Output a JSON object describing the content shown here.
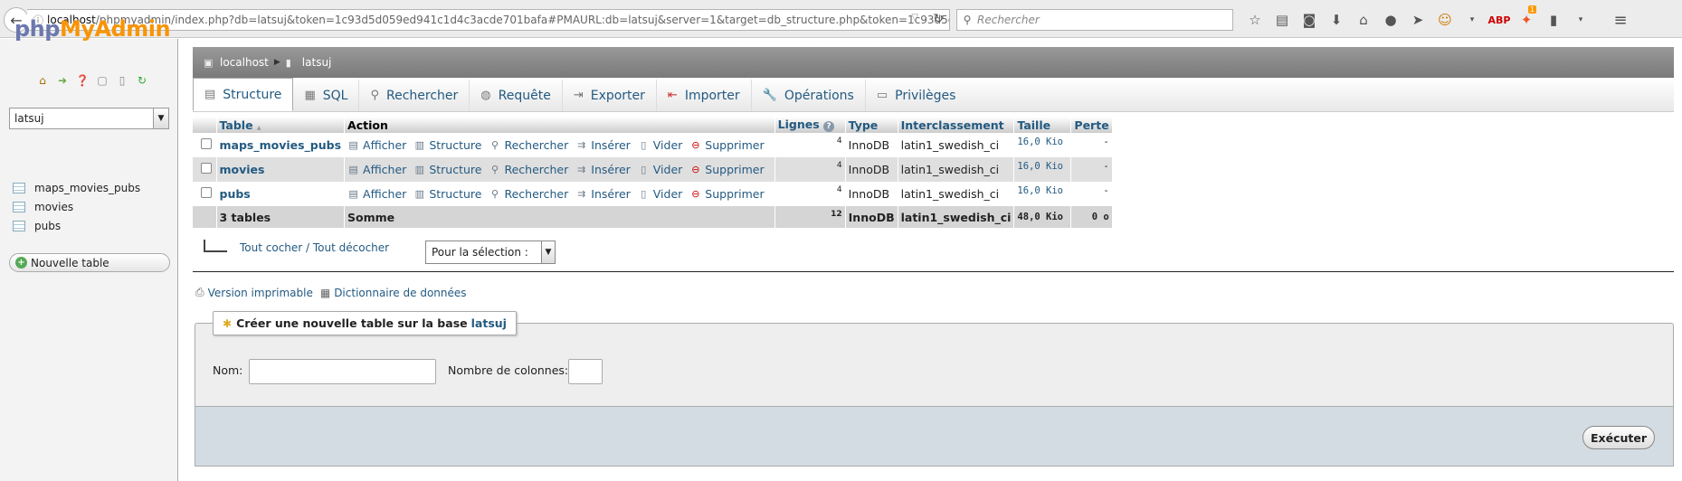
{
  "browser": {
    "url_host": "localhost",
    "url_rest": "/phpmyadmin/index.php?db=latsuj&token=1c93d5d059ed941c1d4c3acde701bafa#PMAURL:db=latsuj&server=1&target=db_structure.php&token=1c93d5d059ed941c1",
    "search_placeholder": "Rechercher",
    "badge": "1"
  },
  "sidebar": {
    "logo_php": "php",
    "logo_my": "MyAdmin",
    "db_selected": "latsuj",
    "tables": [
      {
        "label": "maps_movies_pubs"
      },
      {
        "label": "movies"
      },
      {
        "label": "pubs"
      }
    ],
    "new_table": "Nouvelle table"
  },
  "breadcrumb": {
    "server": "localhost",
    "db": "latsuj"
  },
  "tabs": [
    {
      "label": "Structure",
      "icon": "structure-icon"
    },
    {
      "label": "SQL",
      "icon": "sql-icon"
    },
    {
      "label": "Rechercher",
      "icon": "search-icon"
    },
    {
      "label": "Requête",
      "icon": "query-icon"
    },
    {
      "label": "Exporter",
      "icon": "export-icon"
    },
    {
      "label": "Importer",
      "icon": "import-icon"
    },
    {
      "label": "Opérations",
      "icon": "wrench-icon"
    },
    {
      "label": "Privilèges",
      "icon": "privileges-icon"
    }
  ],
  "table": {
    "headers": {
      "table": "Table",
      "sort_arrow": "▲",
      "action": "Action",
      "rows": "Lignes",
      "type": "Type",
      "collation": "Interclassement",
      "size": "Taille",
      "overhead": "Perte"
    },
    "actions": {
      "browse": "Afficher",
      "structure": "Structure",
      "search": "Rechercher",
      "insert": "Insérer",
      "empty": "Vider",
      "drop": "Supprimer"
    },
    "rows": [
      {
        "name": "maps_movies_pubs",
        "rows": "4",
        "type": "InnoDB",
        "collation": "latin1_swedish_ci",
        "size": "16,0 Kio",
        "overhead": "-"
      },
      {
        "name": "movies",
        "rows": "4",
        "type": "InnoDB",
        "collation": "latin1_swedish_ci",
        "size": "16,0 Kio",
        "overhead": "-"
      },
      {
        "name": "pubs",
        "rows": "4",
        "type": "InnoDB",
        "collation": "latin1_swedish_ci",
        "size": "16,0 Kio",
        "overhead": "-"
      }
    ],
    "summary": {
      "count": "3 tables",
      "label": "Somme",
      "rows": "12",
      "type": "InnoDB",
      "collation": "latin1_swedish_ci",
      "size": "48,0 Kio",
      "overhead": "0 o"
    }
  },
  "bulk": {
    "check_all": "Tout cocher / Tout décocher",
    "with_selected": "Pour la sélection :"
  },
  "links": {
    "print": "Version imprimable",
    "dictionary": "Dictionnaire de données"
  },
  "create": {
    "legend": "Créer une nouvelle table sur la base",
    "db": "latsuj",
    "name_label": "Nom:",
    "cols_label": "Nombre de colonnes:",
    "execute": "Exécuter"
  }
}
